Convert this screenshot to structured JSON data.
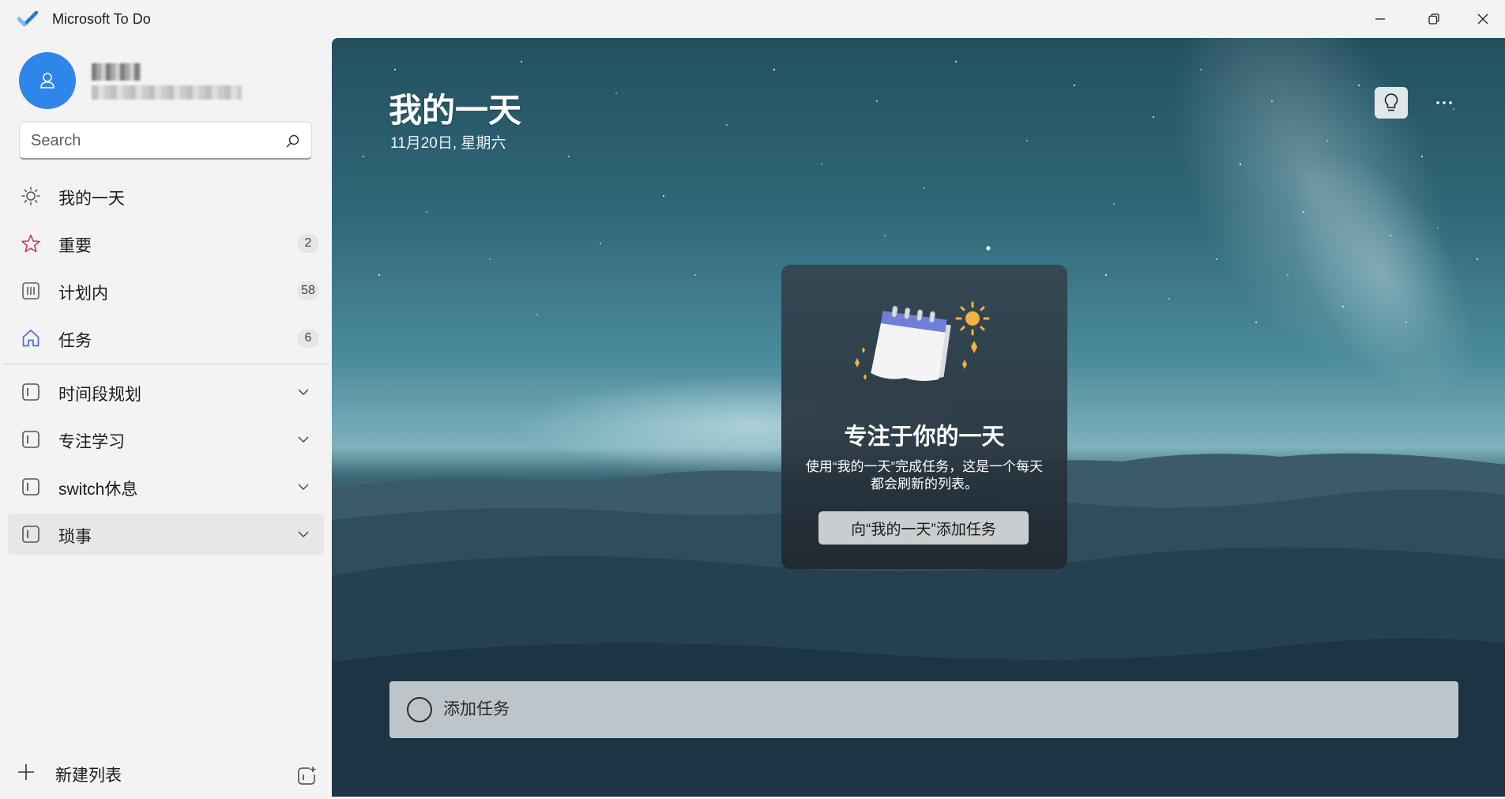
{
  "window": {
    "title": "Microsoft To Do",
    "controls": [
      "minimize-icon",
      "restore-icon",
      "close-icon"
    ]
  },
  "profile": {
    "name": "(blurred)",
    "email": "(blurred)"
  },
  "search": {
    "placeholder": "Search",
    "value": ""
  },
  "sidebar": {
    "smart_lists": [
      {
        "label": "我的一天",
        "icon": "sun-icon",
        "count": ""
      },
      {
        "label": "重要",
        "icon": "star-icon",
        "count": "2"
      },
      {
        "label": "计划内",
        "icon": "calendar-grid-icon",
        "count": "58"
      },
      {
        "label": "任务",
        "icon": "home-icon",
        "count": "6"
      }
    ],
    "groups": [
      {
        "label": "时间段规划",
        "icon": "list-group-icon"
      },
      {
        "label": "专注学习",
        "icon": "list-group-icon"
      },
      {
        "label": "switch休息",
        "icon": "list-group-icon"
      },
      {
        "label": "琐事",
        "icon": "list-group-icon"
      }
    ],
    "new_list_label": "新建列表"
  },
  "main": {
    "title": "我的一天",
    "date": "11月20日, 星期六",
    "empty_state": {
      "title": "专注于你的一天",
      "text": "使用“我的一天”完成任务，这是一个每天都会刷新的列表。",
      "button_label": "向“我的一天”添加任务"
    },
    "add_task_placeholder": "添加任务"
  },
  "colors": {
    "accent": "#2e86ea",
    "important_star": "#c43a5c",
    "home_icon": "#4f6bd8",
    "sidebar_bg": "#f3f3f3"
  }
}
